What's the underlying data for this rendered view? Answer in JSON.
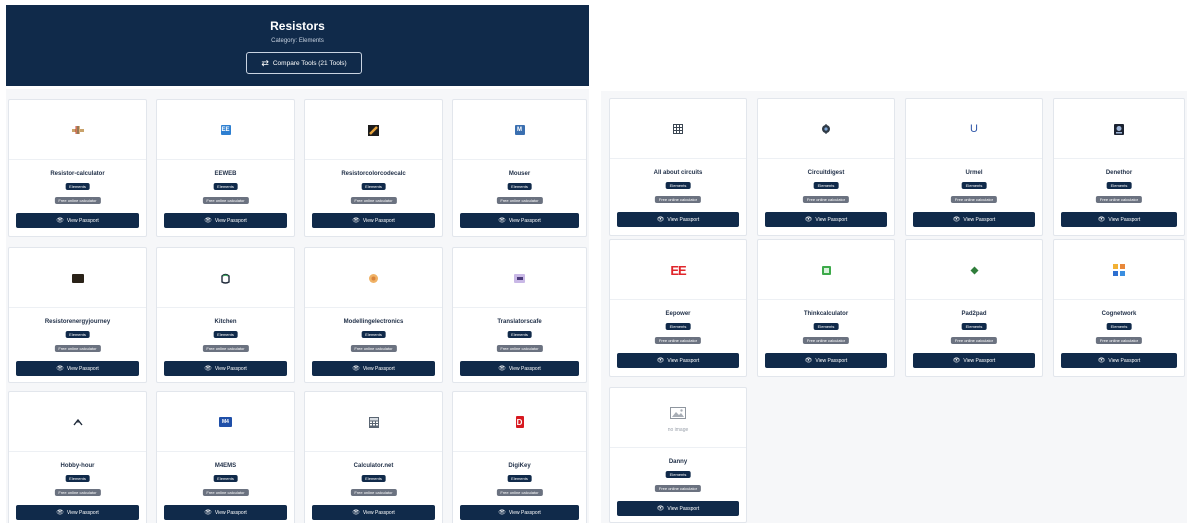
{
  "header": {
    "title": "Resistors",
    "category": "Category: Elements",
    "compare_label": "Compare Tools (21 Tools)"
  },
  "cards": [
    {
      "name": "Resistor-calculator",
      "category": "Elements",
      "tag": "Free online calculator",
      "button": "View Passport",
      "icon": "resistor-logo-icon"
    },
    {
      "name": "EEWEB",
      "category": "Elements",
      "tag": "Free online calculator",
      "button": "View Passport",
      "icon": "eeweb-logo-icon"
    },
    {
      "name": "Resistorcolorcodecalc",
      "category": "Elements",
      "tag": "Free online calculator",
      "button": "View Passport",
      "icon": "resistor-colorcode-logo-icon"
    },
    {
      "name": "Mouser",
      "category": "Elements",
      "tag": "Free online calculator",
      "button": "View Passport",
      "icon": "mouser-logo-icon"
    },
    {
      "name": "Resistorenergyjourney",
      "category": "Elements",
      "tag": "Free online calculator",
      "button": "View Passport",
      "icon": "energyjourney-logo-icon"
    },
    {
      "name": "Kitchen",
      "category": "Elements",
      "tag": "Free online calculator",
      "button": "View Passport",
      "icon": "kitchen-logo-icon"
    },
    {
      "name": "Modellingelectronics",
      "category": "Elements",
      "tag": "Free online calculator",
      "button": "View Passport",
      "icon": "modellingelectronics-logo-icon"
    },
    {
      "name": "Translatorscafe",
      "category": "Elements",
      "tag": "Free online calculator",
      "button": "View Passport",
      "icon": "translatorscafe-logo-icon"
    },
    {
      "name": "Hobby-hour",
      "category": "Elements",
      "tag": "Free online calculator",
      "button": "View Passport",
      "icon": "hobbyhour-logo-icon"
    },
    {
      "name": "M4EMS",
      "category": "Elements",
      "tag": "Free online calculator",
      "button": "View Passport",
      "icon": "m4ems-logo-icon"
    },
    {
      "name": "Calculator.net",
      "category": "Elements",
      "tag": "Free online calculator",
      "button": "View Passport",
      "icon": "calculatornet-logo-icon"
    },
    {
      "name": "DigiKey",
      "category": "Elements",
      "tag": "Free online calculator",
      "button": "View Passport",
      "icon": "digikey-logo-icon"
    },
    {
      "name": "All about circuits",
      "category": "Elements",
      "tag": "Free online calculator",
      "button": "View Passport",
      "icon": "allaboutcircuits-logo-icon"
    },
    {
      "name": "Circuitdigest",
      "category": "Elements",
      "tag": "Free online calculator",
      "button": "View Passport",
      "icon": "circuitdigest-logo-icon"
    },
    {
      "name": "Urmel",
      "category": "Elements",
      "tag": "Free online calculator",
      "button": "View Passport",
      "icon": "urmel-logo-icon"
    },
    {
      "name": "Denethor",
      "category": "Elements",
      "tag": "Free online calculator",
      "button": "View Passport",
      "icon": "denethor-logo-icon"
    },
    {
      "name": "Eepower",
      "category": "Elements",
      "tag": "Free online calculator",
      "button": "View Passport",
      "icon": "eepower-logo-icon"
    },
    {
      "name": "Thinkcalculator",
      "category": "Elements",
      "tag": "Free online calculator",
      "button": "View Passport",
      "icon": "thinkcalculator-logo-icon"
    },
    {
      "name": "Pad2pad",
      "category": "Elements",
      "tag": "Free online calculator",
      "button": "View Passport",
      "icon": "pad2pad-logo-icon"
    },
    {
      "name": "Cognetwork",
      "category": "Elements",
      "tag": "Free online calculator",
      "button": "View Passport",
      "icon": "cognetwork-logo-icon"
    },
    {
      "name": "Danny",
      "category": "Elements",
      "tag": "Free online calculator",
      "button": "View Passport",
      "icon": "no-image-icon",
      "no_image_label": "no image"
    }
  ],
  "colors": {
    "navy": "#102a4a",
    "tag_gray": "#6b7280",
    "panel_bg": "#f6f7f9"
  }
}
